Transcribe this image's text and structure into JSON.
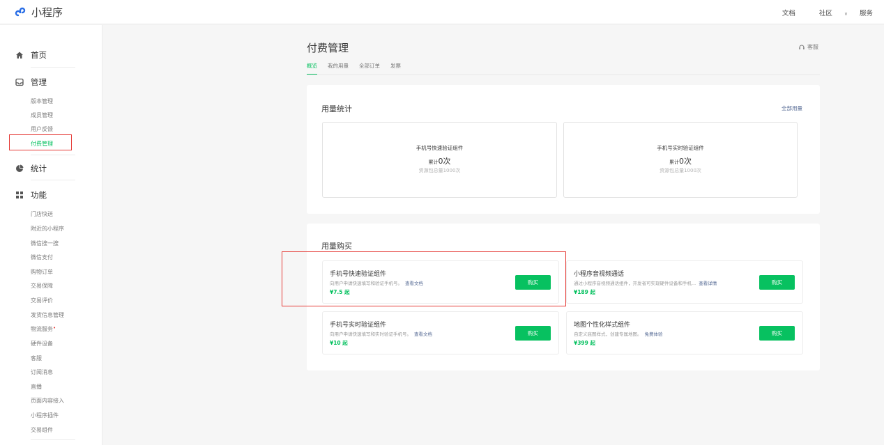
{
  "brand": {
    "name": "小程序",
    "accent": "#07c160",
    "link": "#576b95",
    "highlight": "#e53935"
  },
  "topnav": {
    "docs": "文档",
    "community": "社区",
    "services": "服务"
  },
  "sidebar": {
    "home": "首页",
    "manage": "管理",
    "manage_items": [
      "版本管理",
      "成员管理",
      "用户反馈",
      "付费管理"
    ],
    "stats": "统计",
    "features": "功能",
    "feature_items": [
      "门店快送",
      "附近的小程序",
      "微信搜一搜",
      "微信支付",
      "购物订单",
      "交易保障",
      "交易评价",
      "发货信息管理",
      "物流服务",
      "硬件设备",
      "客服",
      "订阅消息",
      "直播",
      "页面内容接入",
      "小程序插件",
      "交易组件"
    ]
  },
  "page": {
    "title": "付费管理",
    "service": "客服",
    "tabs": [
      "概览",
      "我的用量",
      "全部订单",
      "发票"
    ]
  },
  "usage": {
    "title": "用量统计",
    "all_link": "全部用量",
    "items": [
      {
        "name": "手机号快速验证组件",
        "prefix": "累计",
        "count": "0次",
        "sub": "资源包总量1000次"
      },
      {
        "name": "手机号实时验证组件",
        "prefix": "累计",
        "count": "0次",
        "sub": "资源包总量1000次"
      }
    ]
  },
  "purchase": {
    "title": "用量购买",
    "buy_label": "购买",
    "items": [
      {
        "name": "手机号快速验证组件",
        "desc": "向用户申请快速填写和验证手机号。",
        "link": "查看文档",
        "price": "¥7.5 起"
      },
      {
        "name": "小程序音视频通话",
        "desc": "通过小程序音视频通话组件，开发者可实现硬件设备和手机...",
        "link": "查看详情",
        "price": "¥189 起"
      },
      {
        "name": "手机号实时验证组件",
        "desc": "向用户申请快速填写和实时验证手机号。",
        "link": "查看文档",
        "price": "¥10 起"
      },
      {
        "name": "地图个性化样式组件",
        "desc": "自定义底图样式，创建专属地图。",
        "link": "免费体验",
        "price": "¥399 起"
      }
    ]
  }
}
